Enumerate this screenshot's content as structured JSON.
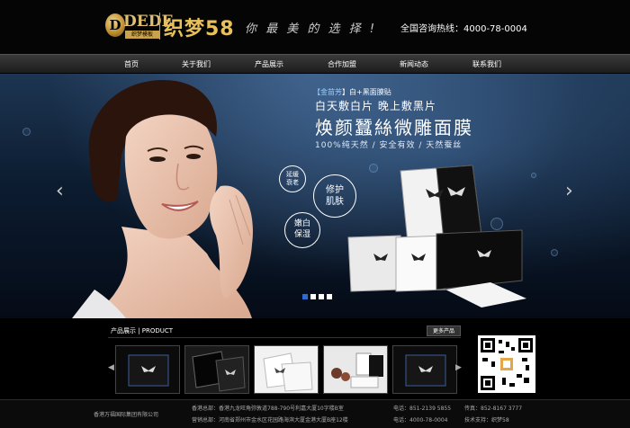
{
  "header": {
    "logo_letter": "D",
    "logo_text": "DEDE",
    "logo_sub": "织梦模板",
    "logo_cn": "织梦58",
    "slogan": "你 最 美 的 选 择 !",
    "hotline": "全国咨询热线：4000-78-0004"
  },
  "nav": {
    "items": [
      "首页",
      "关于我们",
      "产品展示",
      "合作加盟",
      "新闻动态",
      "联系我们"
    ]
  },
  "banner": {
    "badge_brand": "【金苗芳",
    "badge_rest": "】白+黑面膜贴",
    "tag_line": "白天敷白片  晚上敷黑片",
    "main_title": "焕颜蠶絲微雕面膜",
    "sub_title": "100%纯天然 / 安全有效 / 天然蚕丝",
    "circle1": [
      "延缓",
      "衰老"
    ],
    "circle2": [
      "修护",
      "肌肤"
    ],
    "circle3": [
      "嫩白",
      "保湿"
    ],
    "arrow_left": "‹",
    "arrow_right": "›",
    "slide_count": 4,
    "active_slide": 1
  },
  "products": {
    "title": "产品展示 | PRODUCT",
    "more": "更多产品",
    "prev": "◀",
    "next": "▶"
  },
  "footer": {
    "company": "香港万福国际集团有限公司",
    "hq": "香港总部：香港九龙旺角弥敦道788-790号利嘉大厦10字楼B室",
    "office": "营销总部：河南省郑州市金水区花园路海滨大厦金港大厦B座12楼",
    "tel1": "电话：851-2139 5855",
    "tel2": "电话：4000-78-0004",
    "fax": "传真：852-8167 3777",
    "support": "技术支持：织梦58"
  },
  "colors": {
    "gold": "#e8c15a",
    "accent_blue": "#2a6cd1"
  }
}
